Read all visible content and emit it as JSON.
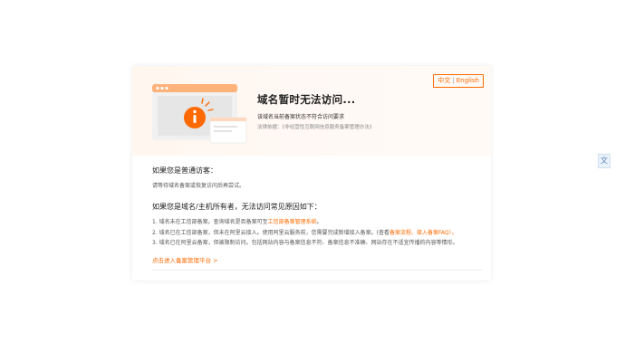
{
  "lang_switch": {
    "zh": "中文",
    "separator": "|",
    "en": "English"
  },
  "hero": {
    "title": "域名暂时无法访问...",
    "desc": "该域名当前备案状态不符合访问要求",
    "law_prefix": "法律依据：",
    "law_text": "《非经营性互联网信息服务备案管理办法》"
  },
  "visitor": {
    "heading": "如果您是普通访客：",
    "text": "请等待域名备案或恢复访问后再尝试。"
  },
  "owner": {
    "heading": "如果您是域名/主机所有者，无法访问常见原因如下：",
    "item1_pre": "1. 域名未在工信部备案。查询域名是否备案可至",
    "item1_link": "工信部备案管理系统",
    "item1_post": "。",
    "item2_pre": "2. 域名已在工信部备案，但未在阿里云接入。使用阿里云服务前，您需要完成新增接入备案。(查看",
    "item2_link": "备案流程、接入备案FAQ",
    "item2_post": "）。",
    "item3": "3. 域名已在阿里云备案，但被限制访问。包括网站内容与备案信息不符、备案信息不准确、网站存在不适宜传播的内容等情形。"
  },
  "cta": "点击进入备案管理平台 >",
  "colors": {
    "accent": "#ff6a00",
    "hero_bg": "#fff6ef"
  },
  "icons": {
    "illustration": "browser-warning-illustration",
    "side": "translate-icon"
  }
}
